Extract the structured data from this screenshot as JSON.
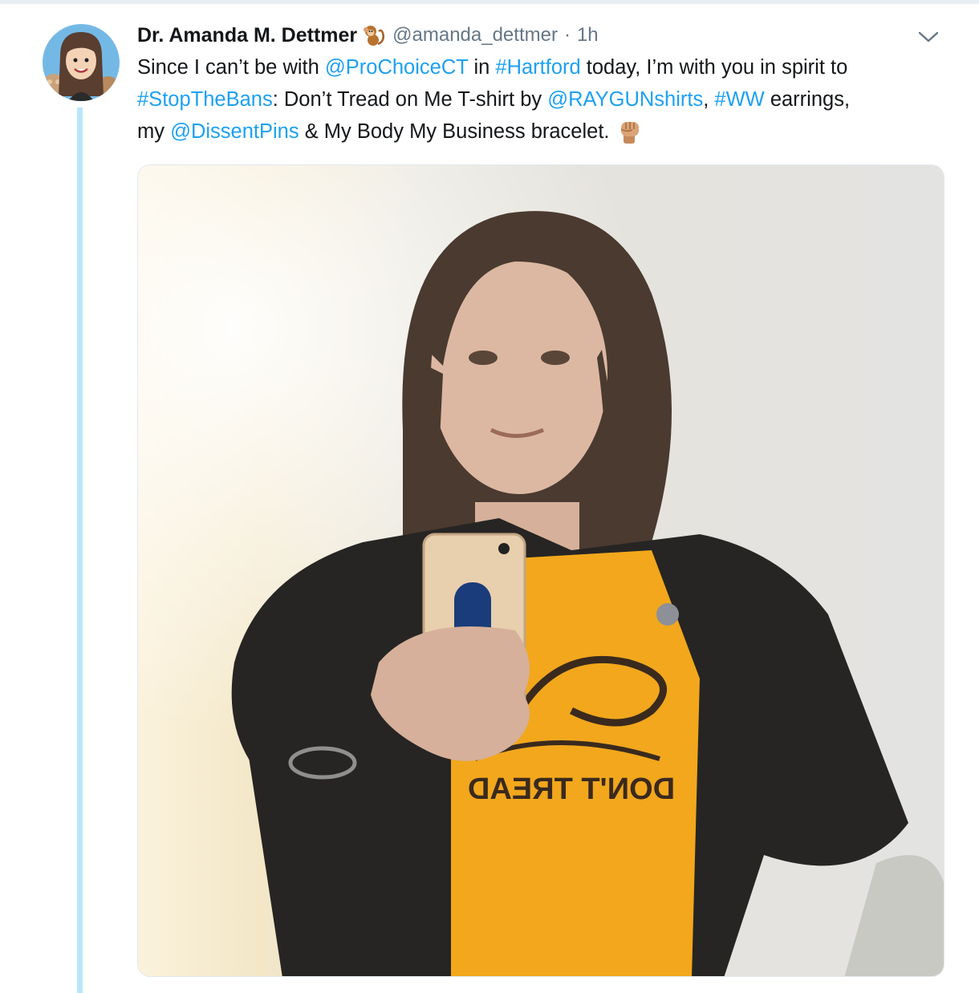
{
  "tweet": {
    "author_name": "Dr. Amanda M. Dettmer",
    "author_handle": "@amanda_dettmer",
    "separator": "·",
    "timestamp": "1h",
    "lines": [
      [
        "Since I can’t be with ",
        "@ProChoiceCT",
        " in ",
        "#Hartford",
        " today, I’m with you in spirit to"
      ],
      [
        "#StopTheBans",
        ": Don’t Tread on Me T-shirt by ",
        "@RAYGUNshirts",
        ", ",
        "#WW",
        " earrings,"
      ],
      [
        "my ",
        "@DissentPins",
        " & My Body My Business bracelet."
      ]
    ],
    "emoji": "raised-fist-medium-skin-tone",
    "shirt_text": "DON'T TREAD"
  },
  "icons": {
    "avatar": "cartoon-avatar-icon",
    "name_emoji": "monkey-icon",
    "menu": "chevron-down-icon"
  },
  "colors": {
    "link": "#1da1f2",
    "text": "#14171a",
    "secondary": "#657786",
    "thread_line": "#b8e7fb",
    "border": "#e1e8ed",
    "shirt": "#f2a71c"
  }
}
